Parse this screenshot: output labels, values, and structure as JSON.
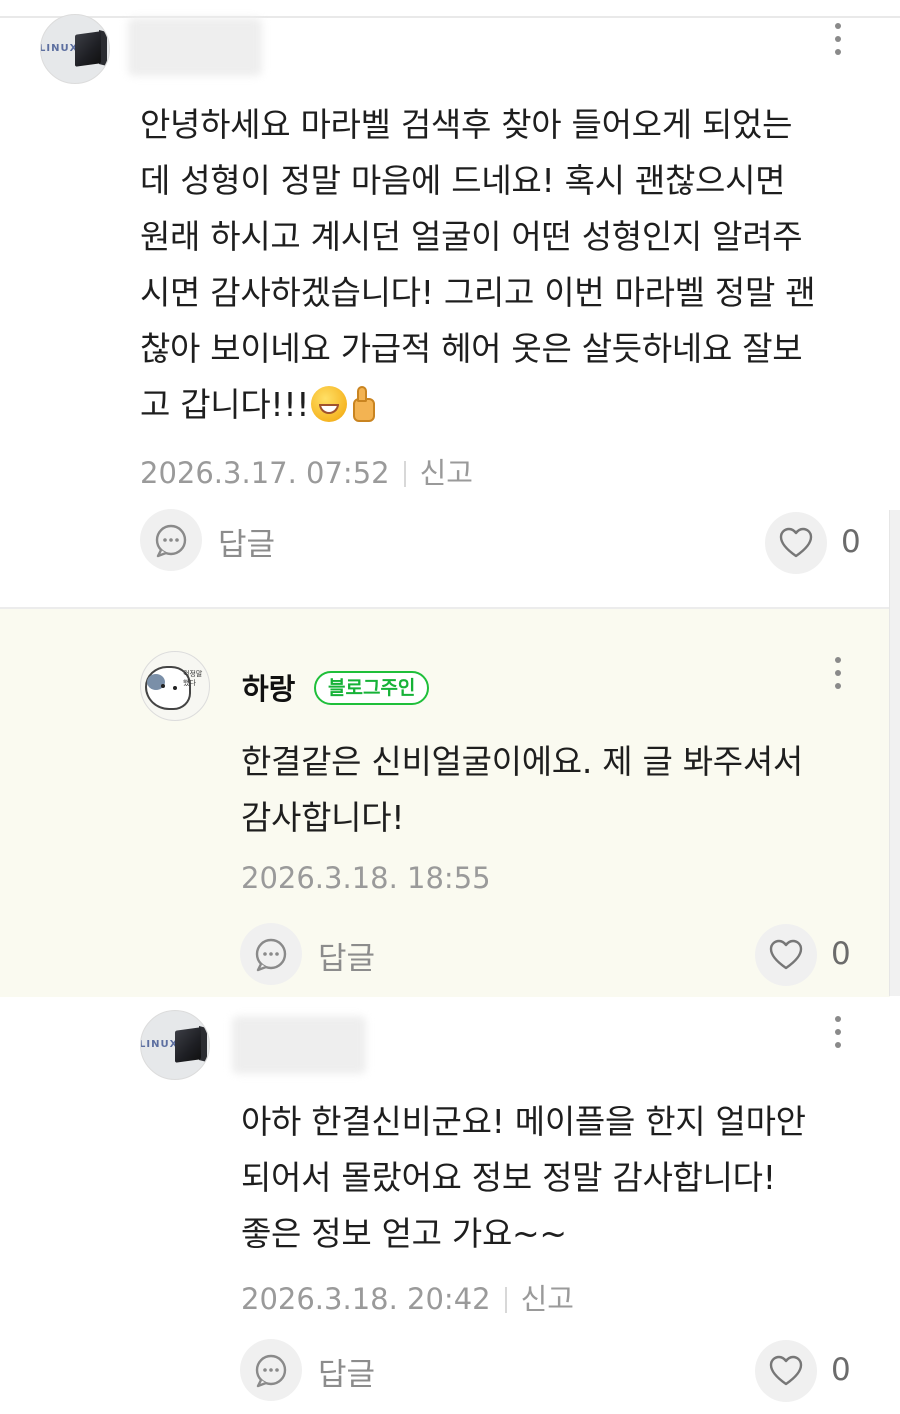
{
  "comments": [
    {
      "author": "",
      "is_owner": false,
      "lines": [
        "안녕하세요 마라벨 검색후 찾아 들어오게 되었는",
        "데 성형이 정말 마음에 드네요! 혹시 괜찮으시면",
        "원래 하시고 계시던 얼굴이 어떤 성형인지 알려주",
        "시면 감사하겠습니다! 그리고 이번 마라벨 정말 괜",
        "찮아 보이네요 가급적 헤어 옷은 살듯하네요 잘보",
        "고 갑니다!!!"
      ],
      "emoji": [
        "grinning-face",
        "thumbs-up"
      ],
      "date": "2026.3.17. 07:52",
      "report_label": "신고",
      "reply_label": "답글",
      "like_count": "0"
    },
    {
      "author": "하랑",
      "is_owner": true,
      "owner_badge": "블로그주인",
      "lines": [
        "한결같은 신비얼굴이에요. 제 글 봐주셔서",
        "감사합니다!"
      ],
      "date": "2026.3.18. 18:55",
      "reply_label": "답글",
      "like_count": "0"
    },
    {
      "author": "",
      "is_owner": false,
      "lines": [
        "아하 한결신비군요! 메이플을 한지 얼마안",
        "되어서 몰랐어요 정보 정말 감사합니다!",
        "좋은 정보 얻고 가요~~"
      ],
      "date": "2026.3.18. 20:42",
      "report_label": "신고",
      "reply_label": "답글",
      "like_count": "0"
    }
  ],
  "avatars": {
    "commenter_logo": "LINUX",
    "owner_avatar_caption": "걱정말 했다"
  },
  "colors": {
    "owner_badge": "#16b237",
    "reply_background": "#fafaf0",
    "meta_text": "#9a9a9a"
  },
  "icons": [
    "more-vertical-icon",
    "speech-bubble-icon",
    "heart-icon"
  ]
}
